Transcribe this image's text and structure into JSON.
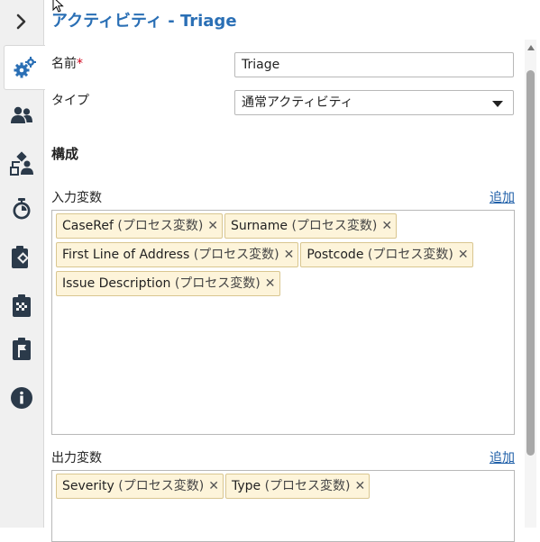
{
  "rail": {
    "items": [
      {
        "icon": "chevron-right-icon"
      },
      {
        "icon": "gears-icon",
        "active": true
      },
      {
        "icon": "users-icon"
      },
      {
        "icon": "user-hierarchy-icon"
      },
      {
        "icon": "timer-icon"
      },
      {
        "icon": "clipboard-diamond-icon"
      },
      {
        "icon": "clipboard-checkered-icon"
      },
      {
        "icon": "clipboard-flag-icon"
      },
      {
        "icon": "info-icon"
      }
    ]
  },
  "header": {
    "title": "アクティビティ  - Triage"
  },
  "form": {
    "name_label": "名前",
    "required_mark": "*",
    "name_value": "Triage",
    "type_label": "タイプ",
    "type_value": "通常アクティビティ"
  },
  "config": {
    "section_title": "構成",
    "input_vars": {
      "label": "入力変数",
      "add_label": "追加",
      "tags": [
        {
          "name": "CaseRef",
          "scope": "(プロセス変数)"
        },
        {
          "name": "Surname",
          "scope": "(プロセス変数)"
        },
        {
          "name": "First Line of Address",
          "scope": "(プロセス変数)"
        },
        {
          "name": "Postcode",
          "scope": "(プロセス変数)"
        },
        {
          "name": "Issue Description",
          "scope": "(プロセス変数)"
        }
      ]
    },
    "output_vars": {
      "label": "出力変数",
      "add_label": "追加",
      "tags": [
        {
          "name": "Severity",
          "scope": "(プロセス変数)"
        },
        {
          "name": "Type",
          "scope": "(プロセス変数)"
        }
      ]
    }
  },
  "colors": {
    "accent": "#2a6fb5",
    "link": "#1f5fa8",
    "tag_bg": "#fdf4da",
    "icon": "#2b3a4a"
  }
}
